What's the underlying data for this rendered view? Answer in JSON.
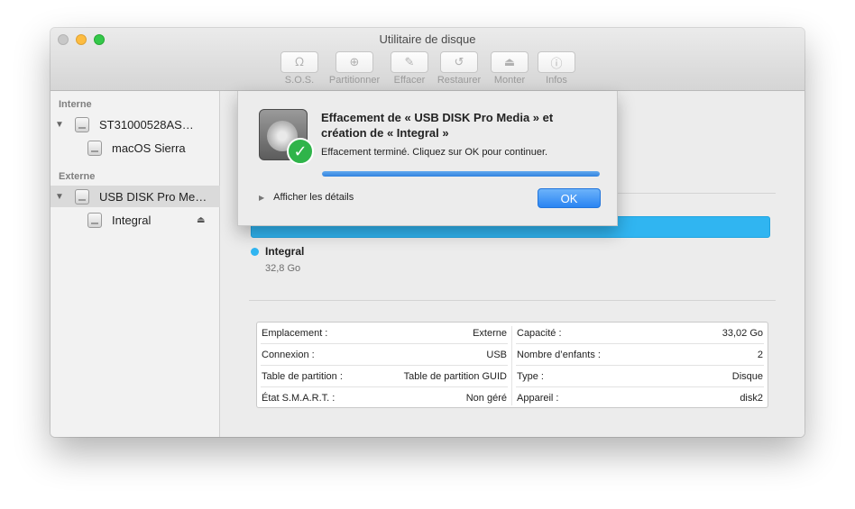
{
  "window": {
    "title": "Utilitaire de disque"
  },
  "toolbar": {
    "buttons": [
      {
        "label": "S.O.S.",
        "icon": "stethoscope-icon"
      },
      {
        "label": "Partitionner",
        "icon": "partition-icon"
      },
      {
        "label": "Effacer",
        "icon": "erase-icon"
      },
      {
        "label": "Restaurer",
        "icon": "restore-icon"
      },
      {
        "label": "Monter",
        "icon": "mount-icon"
      },
      {
        "label": "Infos",
        "icon": "info-icon"
      }
    ]
  },
  "sidebar": {
    "internal_header": "Interne",
    "external_header": "Externe",
    "items": [
      {
        "label": "ST31000528AS…"
      },
      {
        "label": "macOS Sierra"
      },
      {
        "label": "USB DISK Pro Me…"
      },
      {
        "label": "Integral"
      }
    ]
  },
  "volume": {
    "name": "Integral",
    "size": "32,8 Go",
    "color": "#30b5f1"
  },
  "info": {
    "left": [
      {
        "key": "Emplacement :",
        "value": "Externe"
      },
      {
        "key": "Connexion :",
        "value": "USB"
      },
      {
        "key": "Table de partition :",
        "value": "Table de partition GUID"
      },
      {
        "key": "État S.M.A.R.T. :",
        "value": "Non géré"
      }
    ],
    "right": [
      {
        "key": "Capacité :",
        "value": "33,02 Go"
      },
      {
        "key": "Nombre d’enfants :",
        "value": "2"
      },
      {
        "key": "Type :",
        "value": "Disque"
      },
      {
        "key": "Appareil :",
        "value": "disk2"
      }
    ]
  },
  "dialog": {
    "title": "Effacement de « USB DISK Pro Media » et création de « Integral »",
    "message": "Effacement terminé. Cliquez sur OK pour continuer.",
    "progress": 1.0,
    "details_label": "Afficher les détails",
    "ok_label": "OK",
    "accent": "#3183df"
  }
}
